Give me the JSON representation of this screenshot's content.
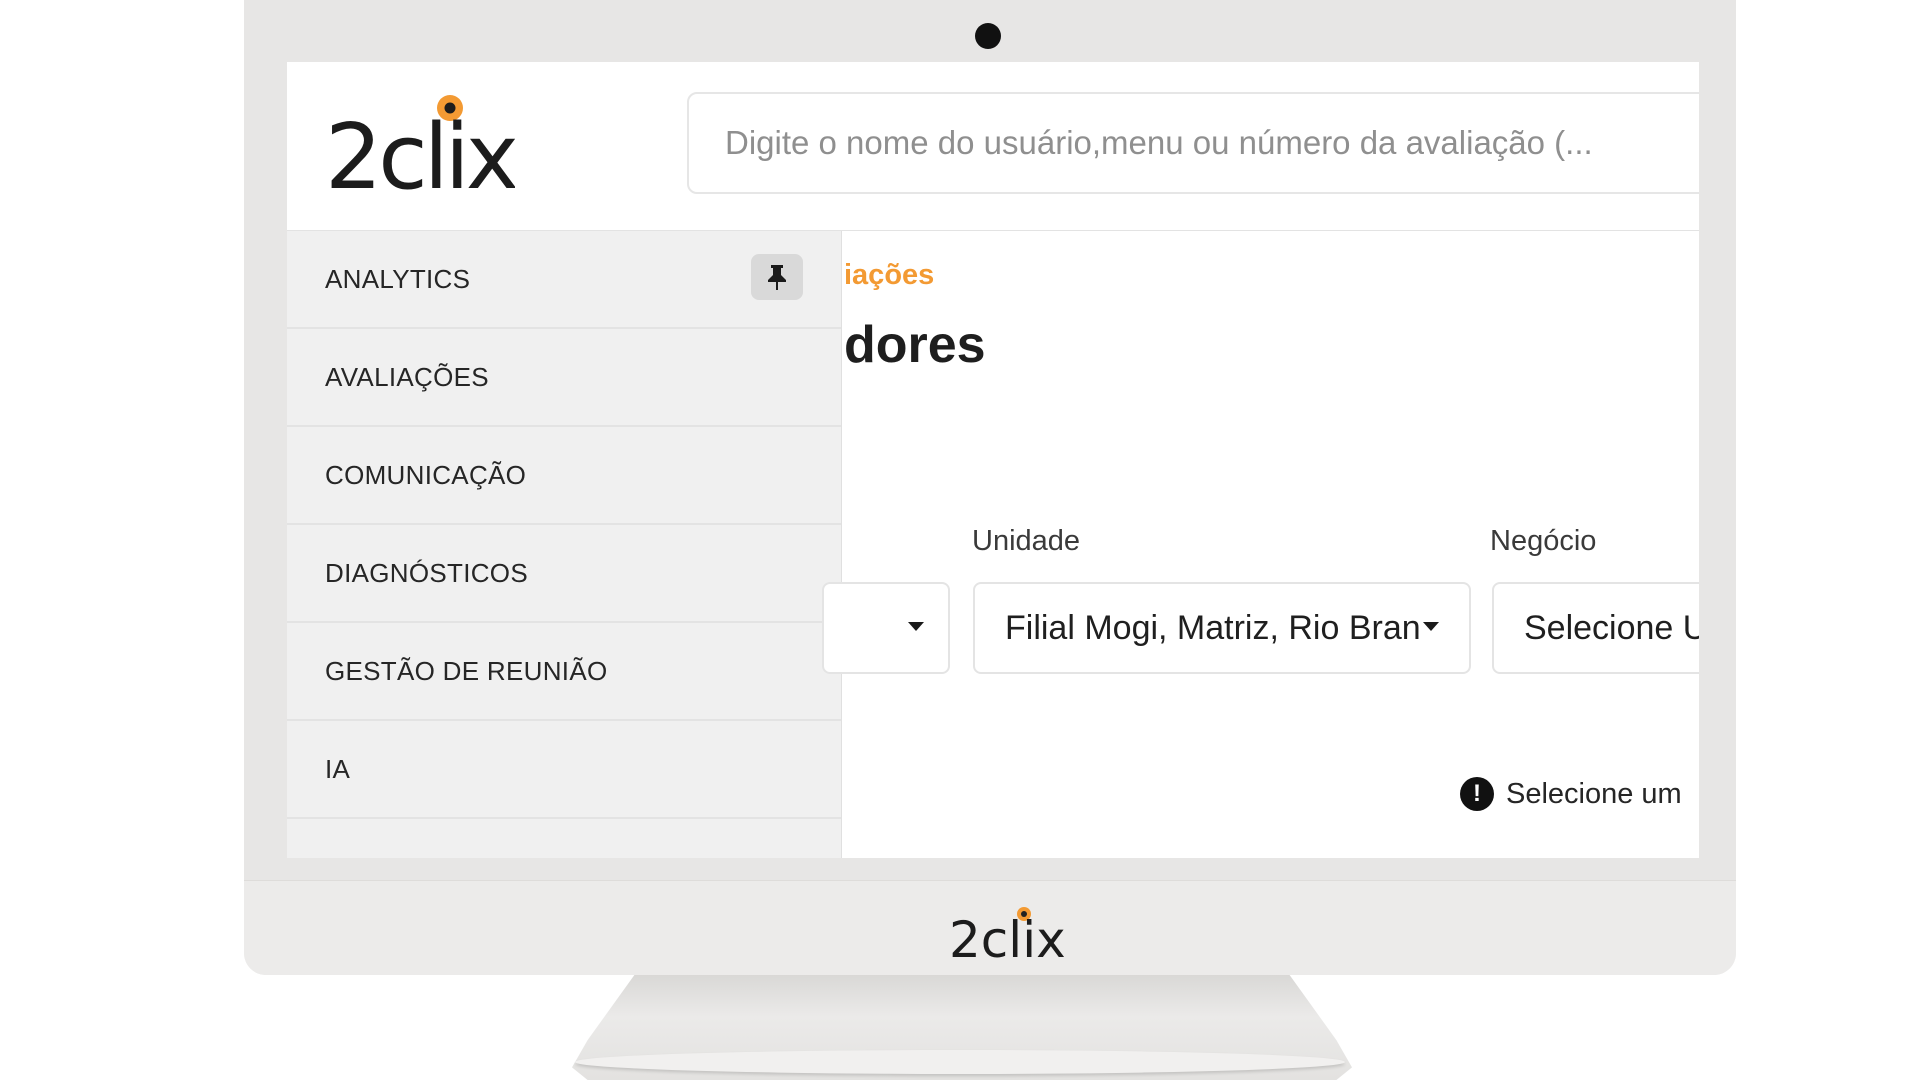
{
  "brand": {
    "logo_text": "2clix",
    "accent": "#f39a33"
  },
  "header": {
    "search_placeholder": "Digite o nome do usuário,menu ou número da avaliação (..."
  },
  "sidebar": {
    "items": [
      {
        "label": "ANALYTICS",
        "pinned": true,
        "icon": "pin-icon"
      },
      {
        "label": "AVALIAÇÕES"
      },
      {
        "label": "COMUNICAÇÃO"
      },
      {
        "label": "DIAGNÓSTICOS"
      },
      {
        "label": "GESTÃO DE REUNIÃO"
      },
      {
        "label": "IA"
      }
    ]
  },
  "main": {
    "breadcrumb": "iações",
    "title": "dores",
    "filters": {
      "unidade_label": "Unidade",
      "unidade_value": "Filial Mogi, Matriz, Rio Bran",
      "negocio_label": "Negócio",
      "negocio_value": "Selecione U"
    },
    "warning": "Selecione um"
  }
}
